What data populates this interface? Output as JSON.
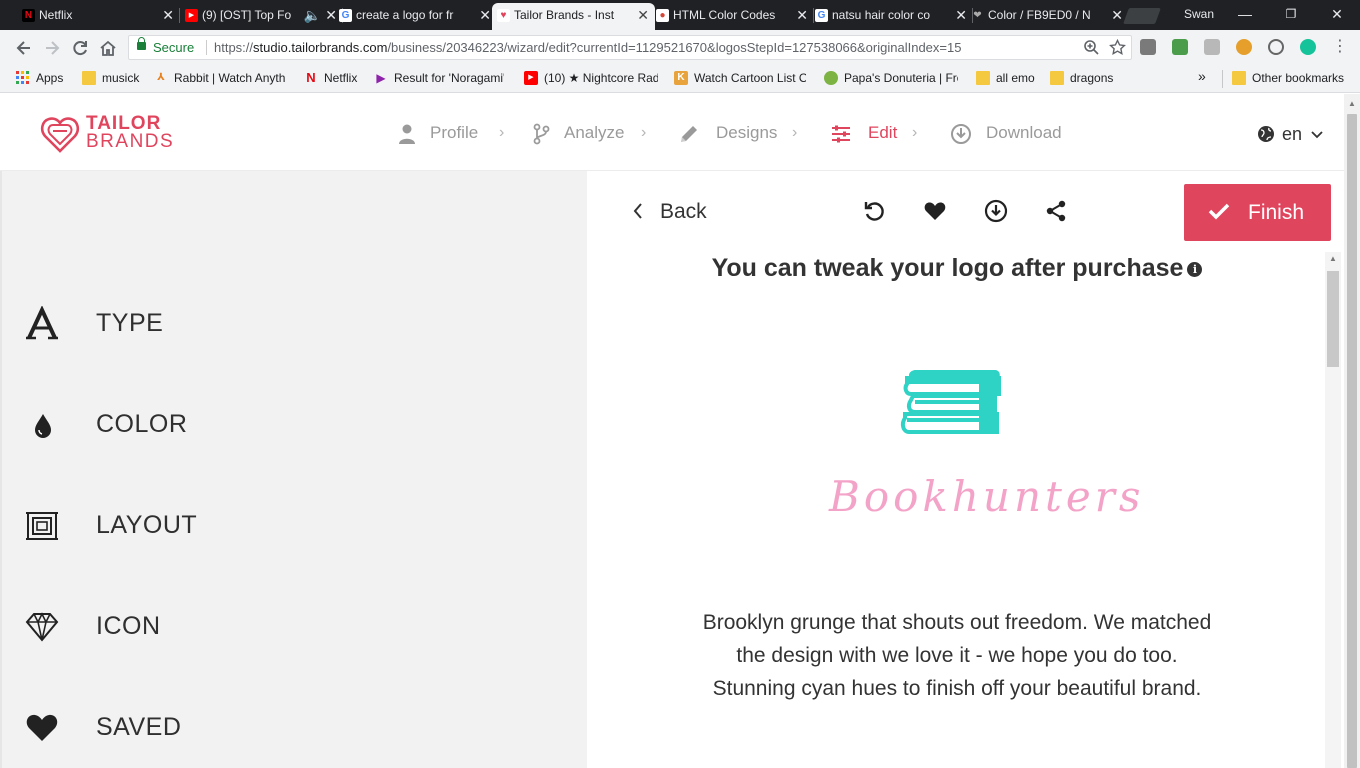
{
  "browser": {
    "tabs": [
      {
        "title": "Netflix",
        "favicon": "N",
        "favicon_color": "#e50914"
      },
      {
        "title": "(9) [OST] Top Fo",
        "favicon": "▶",
        "favicon_color": "#ff0000"
      },
      {
        "title": "create a logo for fr",
        "favicon": "G",
        "favicon_color": "#4285f4"
      },
      {
        "title": "Tailor Brands - Inst",
        "favicon": "♥",
        "favicon_color": "#e0455e"
      },
      {
        "title": "HTML Color Codes",
        "favicon": "●",
        "favicon_color": "#d44638"
      },
      {
        "title": "natsu hair color co",
        "favicon": "G",
        "favicon_color": "#4285f4"
      },
      {
        "title": "Color / FB9ED0 / N",
        "favicon": "❤",
        "favicon_color": "#888888"
      }
    ],
    "profile_name": "Swan",
    "address": {
      "secure_label": "Secure",
      "url_scheme": "https://",
      "url_host": "studio.tailorbrands.com",
      "url_path": "/business/20346223/wizard/edit?currentId=1129521670&logosStepId=127538066&originalIndex=15"
    },
    "bookmarks": [
      {
        "label": "Apps",
        "icon": "apps-grid-icon"
      },
      {
        "label": "musick",
        "icon": "folder-icon"
      },
      {
        "label": "Rabbit | Watch Anyth",
        "icon": "rabbit-icon"
      },
      {
        "label": "Netflix",
        "icon": "netflix-icon"
      },
      {
        "label": "Result for 'Noragami'",
        "icon": "play-icon"
      },
      {
        "label": "(10) ★ Nightcore Rad",
        "icon": "youtube-icon"
      },
      {
        "label": "Watch Cartoon List O",
        "icon": "k-icon"
      },
      {
        "label": "Papa's Donuteria | Fre",
        "icon": "game-icon"
      },
      {
        "label": "all emo",
        "icon": "folder-icon"
      },
      {
        "label": "dragons",
        "icon": "folder-icon"
      }
    ],
    "overflow_label": "»",
    "other_bookmarks": "Other bookmarks"
  },
  "site": {
    "logo_line1": "TAILOR",
    "logo_line2": "BRANDS",
    "brand_color": "#e0455e",
    "steps": [
      {
        "label": "Profile",
        "icon": "user-icon",
        "active": false
      },
      {
        "label": "Analyze",
        "icon": "analyze-icon",
        "active": false
      },
      {
        "label": "Designs",
        "icon": "pencil-icon",
        "active": false
      },
      {
        "label": "Edit",
        "icon": "sliders-icon",
        "active": true
      },
      {
        "label": "Download",
        "icon": "download-circle-icon",
        "active": false
      }
    ],
    "language": "en"
  },
  "sidebar": {
    "items": [
      {
        "label": "TYPE",
        "icon": "type-a-icon"
      },
      {
        "label": "COLOR",
        "icon": "droplet-icon"
      },
      {
        "label": "LAYOUT",
        "icon": "layout-icon"
      },
      {
        "label": "ICON",
        "icon": "diamond-icon"
      },
      {
        "label": "SAVED",
        "icon": "heart-icon"
      }
    ]
  },
  "editor": {
    "back_label": "Back",
    "toolbar_icons": [
      "undo-icon",
      "heart-icon",
      "download-icon",
      "share-icon"
    ],
    "finish_label": "Finish",
    "tweak_text": "You can tweak your logo after purchase",
    "logo": {
      "brand_name": "Bookhunters",
      "icon": "books-stack-icon",
      "icon_color": "#2ed3c6",
      "text_color": "#f4a3c8"
    },
    "description_lines": [
      "Brooklyn grunge that shouts out freedom. We matched",
      "the design with we love it - we hope you do too.",
      "Stunning cyan hues to finish off your beautiful brand."
    ]
  }
}
